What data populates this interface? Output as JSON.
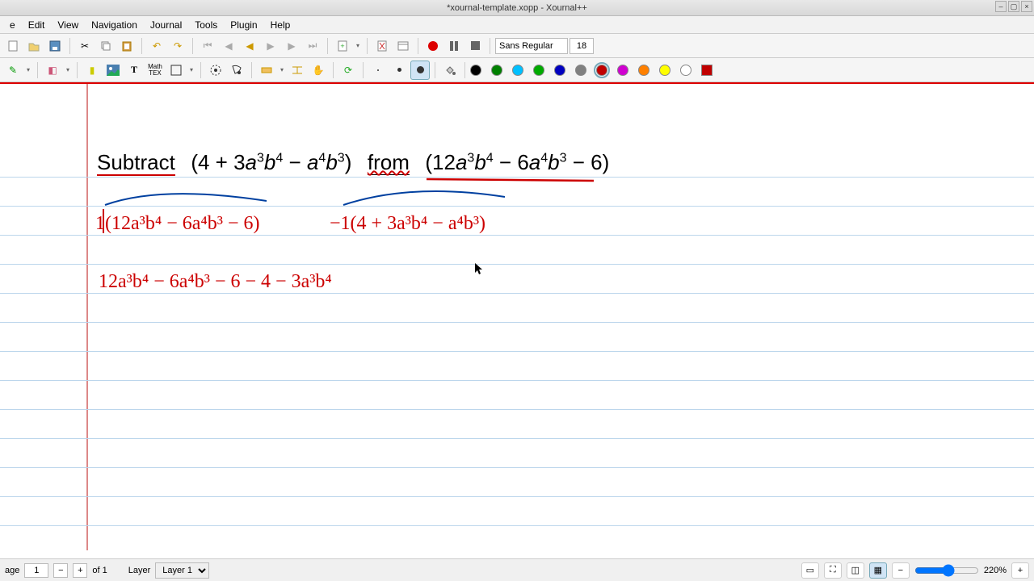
{
  "window": {
    "title": "*xournal-template.xopp - Xournal++"
  },
  "menu": {
    "items": [
      "e",
      "Edit",
      "View",
      "Navigation",
      "Journal",
      "Tools",
      "Plugin",
      "Help"
    ]
  },
  "toolbar": {
    "font_name": "Sans Regular",
    "font_size": "18"
  },
  "colors": {
    "palette": [
      "#000000",
      "#008000",
      "#00c0ff",
      "#00aa00",
      "#0000c0",
      "#808080",
      "#c00000",
      "#d000d0",
      "#ff8000",
      "#ffff00",
      "#ffffff"
    ],
    "selected": "#c00000",
    "fill": "#c00000"
  },
  "canvas": {
    "typed": {
      "word_subtract": "Subtract",
      "expr1": "(4 + 3a³b⁴ − a⁴b³)",
      "word_from": "from",
      "expr2": "(12a³b⁴ − 6a⁴b³ − 6)"
    },
    "hand": {
      "line2a": "1(12a³b⁴ − 6a⁴b³ − 6)",
      "line2b": "−1(4 + 3a³b⁴ − a⁴b³)",
      "line3": "12a³b⁴ − 6a⁴b³ − 6  − 4 − 3a³b⁴"
    }
  },
  "status": {
    "page_label": "age",
    "page_current": "1",
    "page_total": "of 1",
    "layer_label": "Layer",
    "layer_value": "Layer 1",
    "zoom": "220%"
  }
}
